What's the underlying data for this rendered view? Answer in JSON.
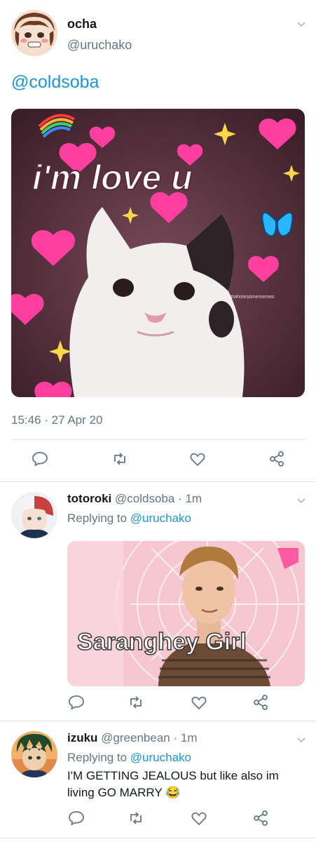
{
  "main_tweet": {
    "name": "ocha",
    "handle": "@uruchako",
    "text": "@coldsoba",
    "image_caption": "i'm love u",
    "image_watermark": "@wholesomememes",
    "timestamp": "15:46 · 27 Apr 20"
  },
  "replies": [
    {
      "name": "totoroki",
      "handle": "@coldsoba",
      "separator": "·",
      "time": "1m",
      "replying_prefix": "Replying to",
      "replying_to": "@uruchako",
      "image_caption": "Saranghey Girl"
    },
    {
      "name": "izuku",
      "handle": "@greenbean",
      "separator": "·",
      "time": "1m",
      "replying_prefix": "Replying to",
      "replying_to": "@uruchako",
      "text": "I'M GETTING JEALOUS but like also im living GO MARRY 😂"
    }
  ],
  "icons": {
    "reply": "reply-icon",
    "retweet": "retweet-icon",
    "like": "heart-icon",
    "share": "share-icon",
    "more": "chevron-down-icon"
  },
  "colors": {
    "link": "#1b95e0",
    "secondary_text": "#657786",
    "primary_text": "#14171a",
    "divider": "#e1e8ed"
  }
}
